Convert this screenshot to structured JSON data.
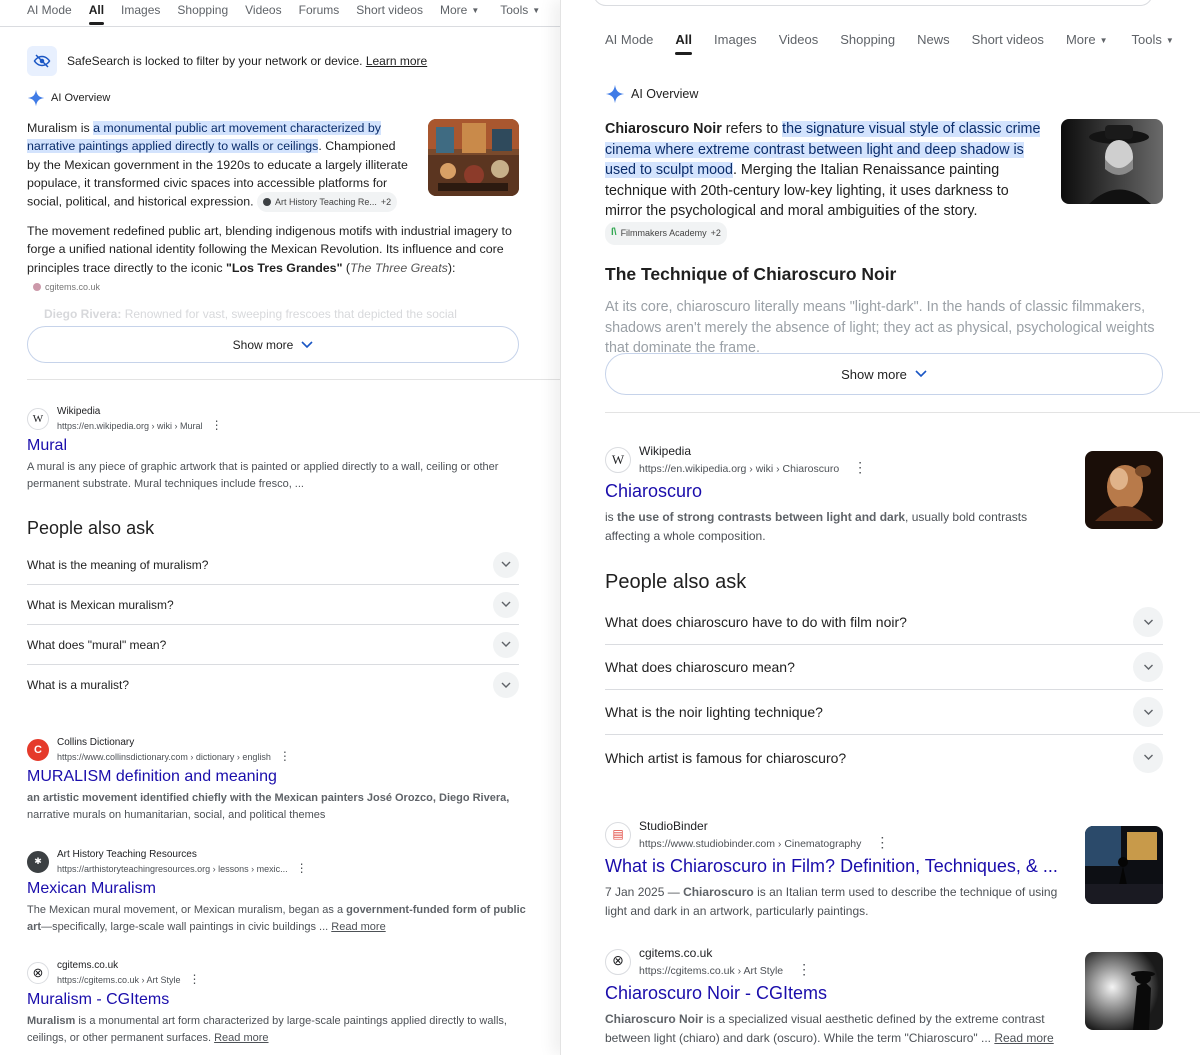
{
  "left": {
    "tabs": [
      {
        "label": "AI Mode"
      },
      {
        "label": "All",
        "active": true
      },
      {
        "label": "Images"
      },
      {
        "label": "Shopping"
      },
      {
        "label": "Videos"
      },
      {
        "label": "Forums"
      },
      {
        "label": "Short videos"
      },
      {
        "label": "More"
      },
      {
        "label": "Tools"
      }
    ],
    "safesearch": {
      "text": "SafeSearch is locked to filter by your network or device.",
      "link": "Learn more"
    },
    "ai_overview": {
      "header": "AI Overview",
      "p1_lead": "Muralism is ",
      "p1_highlight": "a monumental public art movement characterized by narrative paintings applied directly to walls or ceilings",
      "p1_rest": ". Championed by the Mexican government in the 1920s to educate a largely illiterate populace, it transformed civic spaces into accessible platforms for social, political, and historical expression.",
      "p1_chip": "Art History Teaching Re...",
      "p1_chip_count": "+2",
      "p2_a": "The movement redefined public art, blending indigenous motifs with industrial imagery to forge a unified national identity following the Mexican Revolution. Its influence and core principles trace directly to the iconic ",
      "p2_bold": "\"Los Tres Grandes\"",
      "p2_b": " (",
      "p2_italic": "The Three Greats",
      "p2_c": "):",
      "p2_chip": "cgitems.co.uk",
      "faded_bold": "Diego Rivera:",
      "faded": " Renowned for vast, sweeping frescoes that depicted the social",
      "show_more": "Show more"
    },
    "results": [
      {
        "source": "Wikipedia",
        "url": "https://en.wikipedia.org › wiki › Mural",
        "title": "Mural",
        "snippet": "A mural is any piece of graphic artwork that is painted or applied directly to a wall, ceiling or other permanent substrate. Mural techniques include fresco, ..."
      }
    ],
    "paa": {
      "title": "People also ask",
      "questions": [
        "What is the meaning of muralism?",
        "What is Mexican muralism?",
        "What does \"mural\" mean?",
        "What is a muralist?"
      ]
    },
    "results2": [
      {
        "source": "Collins Dictionary",
        "url": "https://www.collinsdictionary.com › dictionary › english",
        "title": "MURALISM definition and meaning",
        "snippet_bold": "an artistic movement identified chiefly with the Mexican painters José Orozco, Diego Rivera,",
        "snippet": " narrative murals on humanitarian, social, and political themes"
      },
      {
        "source": "Art History Teaching Resources",
        "url": "https://arthistoryteachingresources.org › lessons › mexic...",
        "title": "Mexican Muralism",
        "snippet_a": "The Mexican mural movement, or Mexican muralism, began as a ",
        "snippet_bold": "government-funded form of public art",
        "snippet_b": "—specifically, large-scale wall paintings in civic buildings ... ",
        "read_more": "Read more"
      },
      {
        "source": "cgitems.co.uk",
        "url": "https://cgitems.co.uk › Art Style",
        "title": "Muralism - CGItems",
        "snippet_bold": "Muralism",
        "snippet": " is a monumental art form characterized by large-scale paintings applied directly to walls, ceilings, or other permanent surfaces. ",
        "read_more": "Read more"
      }
    ]
  },
  "right": {
    "tabs": [
      {
        "label": "AI Mode"
      },
      {
        "label": "All",
        "active": true
      },
      {
        "label": "Images"
      },
      {
        "label": "Videos"
      },
      {
        "label": "Shopping"
      },
      {
        "label": "News"
      },
      {
        "label": "Short videos"
      },
      {
        "label": "More"
      },
      {
        "label": "Tools"
      }
    ],
    "ai_overview": {
      "header": "AI Overview",
      "p1_bold": "Chiaroscuro Noir",
      "p1_lead": " refers to ",
      "p1_highlight": "the signature visual style of classic crime cinema where extreme contrast between light and deep shadow is used to sculpt mood",
      "p1_rest": ". Merging the Italian Renaissance painting technique with 20th-century low-key lighting, it uses darkness to mirror the psychological and moral ambiguities of the story.",
      "p1_chip": "Filmmakers Academy",
      "p1_chip_count": "+2",
      "subheading": "The Technique of Chiaroscuro Noir",
      "faded": "At its core, chiaroscuro literally means \"light-dark\". In the hands of classic filmmakers, shadows aren't merely the absence of light; they act as physical, psychological weights that dominate the frame.",
      "show_more": "Show more"
    },
    "results": [
      {
        "source": "Wikipedia",
        "url": "https://en.wikipedia.org › wiki › Chiaroscuro",
        "title": "Chiaroscuro",
        "snippet_a": "is ",
        "snippet_bold": "the use of strong contrasts between light and dark",
        "snippet_b": ", usually bold contrasts affecting a whole composition."
      }
    ],
    "paa": {
      "title": "People also ask",
      "questions": [
        "What does chiaroscuro have to do with film noir?",
        "What does chiaroscuro mean?",
        "What is the noir lighting technique?",
        "Which artist is famous for chiaroscuro?"
      ]
    },
    "results2": [
      {
        "source": "StudioBinder",
        "url": "https://www.studiobinder.com › Cinematography",
        "title": "What is Chiaroscuro in Film? Definition, Techniques, & ...",
        "date": "7 Jan 2025 — ",
        "snippet_bold": "Chiaroscuro",
        "snippet": " is an Italian term used to describe the technique of using light and dark in an artwork, particularly paintings."
      },
      {
        "source": "cgitems.co.uk",
        "url": "https://cgitems.co.uk › Art Style",
        "title": "Chiaroscuro Noir - CGItems",
        "snippet_bold": "Chiaroscuro Noir",
        "snippet": " is a specialized visual aesthetic defined by the extreme contrast between light (chiaro) and dark (oscuro). While the term \"Chiaroscuro\" ... ",
        "read_more": "Read more"
      }
    ]
  },
  "colors": {
    "link": "#1a0dab",
    "highlight": "#d3e3fd",
    "text": "#1f1f1f",
    "muted": "#4d5156"
  }
}
